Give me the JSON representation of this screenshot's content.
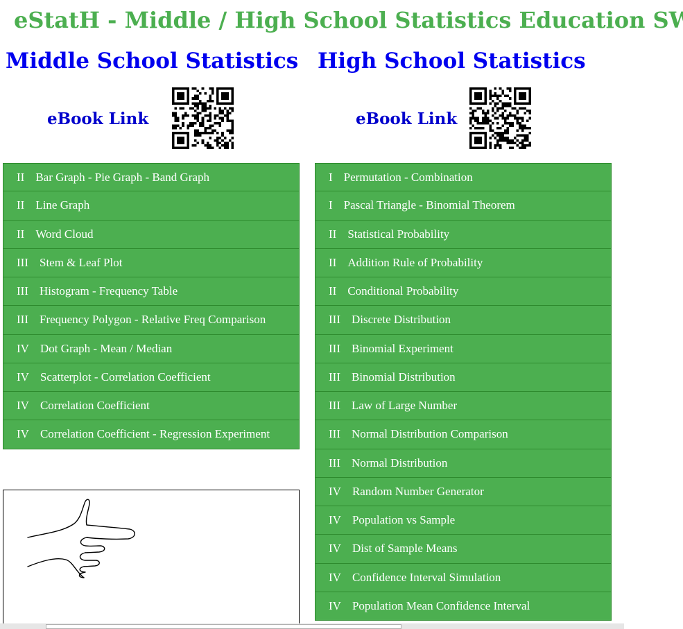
{
  "header": {
    "title": "eStatH - Middle / High School Statistics Education SW"
  },
  "middle_school": {
    "title": "Middle School Statistics",
    "ebook_label": "eBook Link",
    "items": [
      {
        "level": "II",
        "label": "Bar Graph - Pie Graph - Band Graph"
      },
      {
        "level": "II",
        "label": "Line Graph"
      },
      {
        "level": "II",
        "label": "Word Cloud"
      },
      {
        "level": "III",
        "label": "Stem & Leaf Plot"
      },
      {
        "level": "III",
        "label": "Histogram - Frequency Table"
      },
      {
        "level": "III",
        "label": "Frequency Polygon - Relative Freq Comparison"
      },
      {
        "level": "IV",
        "label": "Dot Graph - Mean / Median"
      },
      {
        "level": "IV",
        "label": "Scatterplot - Correlation Coefficient"
      },
      {
        "level": "IV",
        "label": "Correlation Coefficient"
      },
      {
        "level": "IV",
        "label": "Correlation Coefficient - Regression Experiment"
      }
    ]
  },
  "high_school": {
    "title": "High School Statistics",
    "ebook_label": "eBook Link",
    "items": [
      {
        "level": "I",
        "label": "Permutation - Combination"
      },
      {
        "level": "I",
        "label": "Pascal Triangle - Binomial Theorem"
      },
      {
        "level": "II",
        "label": "Statistical Probability"
      },
      {
        "level": "II",
        "label": "Addition Rule of Probability"
      },
      {
        "level": "II",
        "label": "Conditional Probability"
      },
      {
        "level": "III",
        "label": "Discrete Distribution"
      },
      {
        "level": "III",
        "label": "Binomial Experiment"
      },
      {
        "level": "III",
        "label": "Binomial Distribution"
      },
      {
        "level": "III",
        "label": "Law of Large Number"
      },
      {
        "level": "III",
        "label": "Normal Distribution Comparison"
      },
      {
        "level": "III",
        "label": "Normal Distribution"
      },
      {
        "level": "IV",
        "label": "Random Number Generator"
      },
      {
        "level": "IV",
        "label": "Population vs Sample"
      },
      {
        "level": "IV",
        "label": "Dist of Sample Means"
      },
      {
        "level": "IV",
        "label": "Confidence Interval Simulation"
      },
      {
        "level": "IV",
        "label": "Population Mean Confidence Interval"
      }
    ]
  },
  "colors": {
    "menu_green": "#4caf50",
    "menu_border": "#2e8b2e",
    "title_green": "#4caf50",
    "heading_blue": "#0000ee",
    "link_blue": "#0000cc"
  },
  "icons": {
    "qr": "qr-code-icon",
    "pointer": "pointing-hand-icon"
  }
}
